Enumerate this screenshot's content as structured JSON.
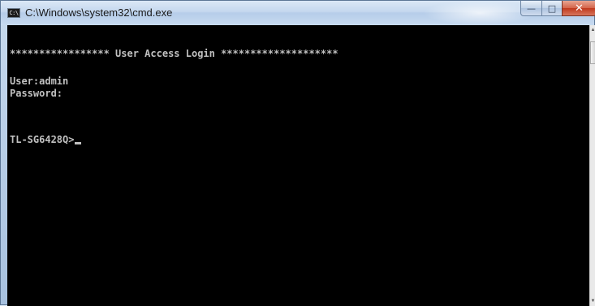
{
  "window": {
    "title": "C:\\Windows\\system32\\cmd.exe",
    "icon": "cmd-icon",
    "icon_text": "C:\\",
    "buttons": {
      "minimize": "minimize-icon",
      "maximize": "maximize-icon",
      "close": "close-icon"
    }
  },
  "console": {
    "lines": [
      "***************** User Access Login ********************",
      "",
      "User:admin",
      "Password:",
      "",
      "",
      "TL-SG6428Q>"
    ]
  },
  "colors": {
    "console_background": "#000000",
    "console_text": "#c0c0c0",
    "close_button": "#c0391d"
  }
}
